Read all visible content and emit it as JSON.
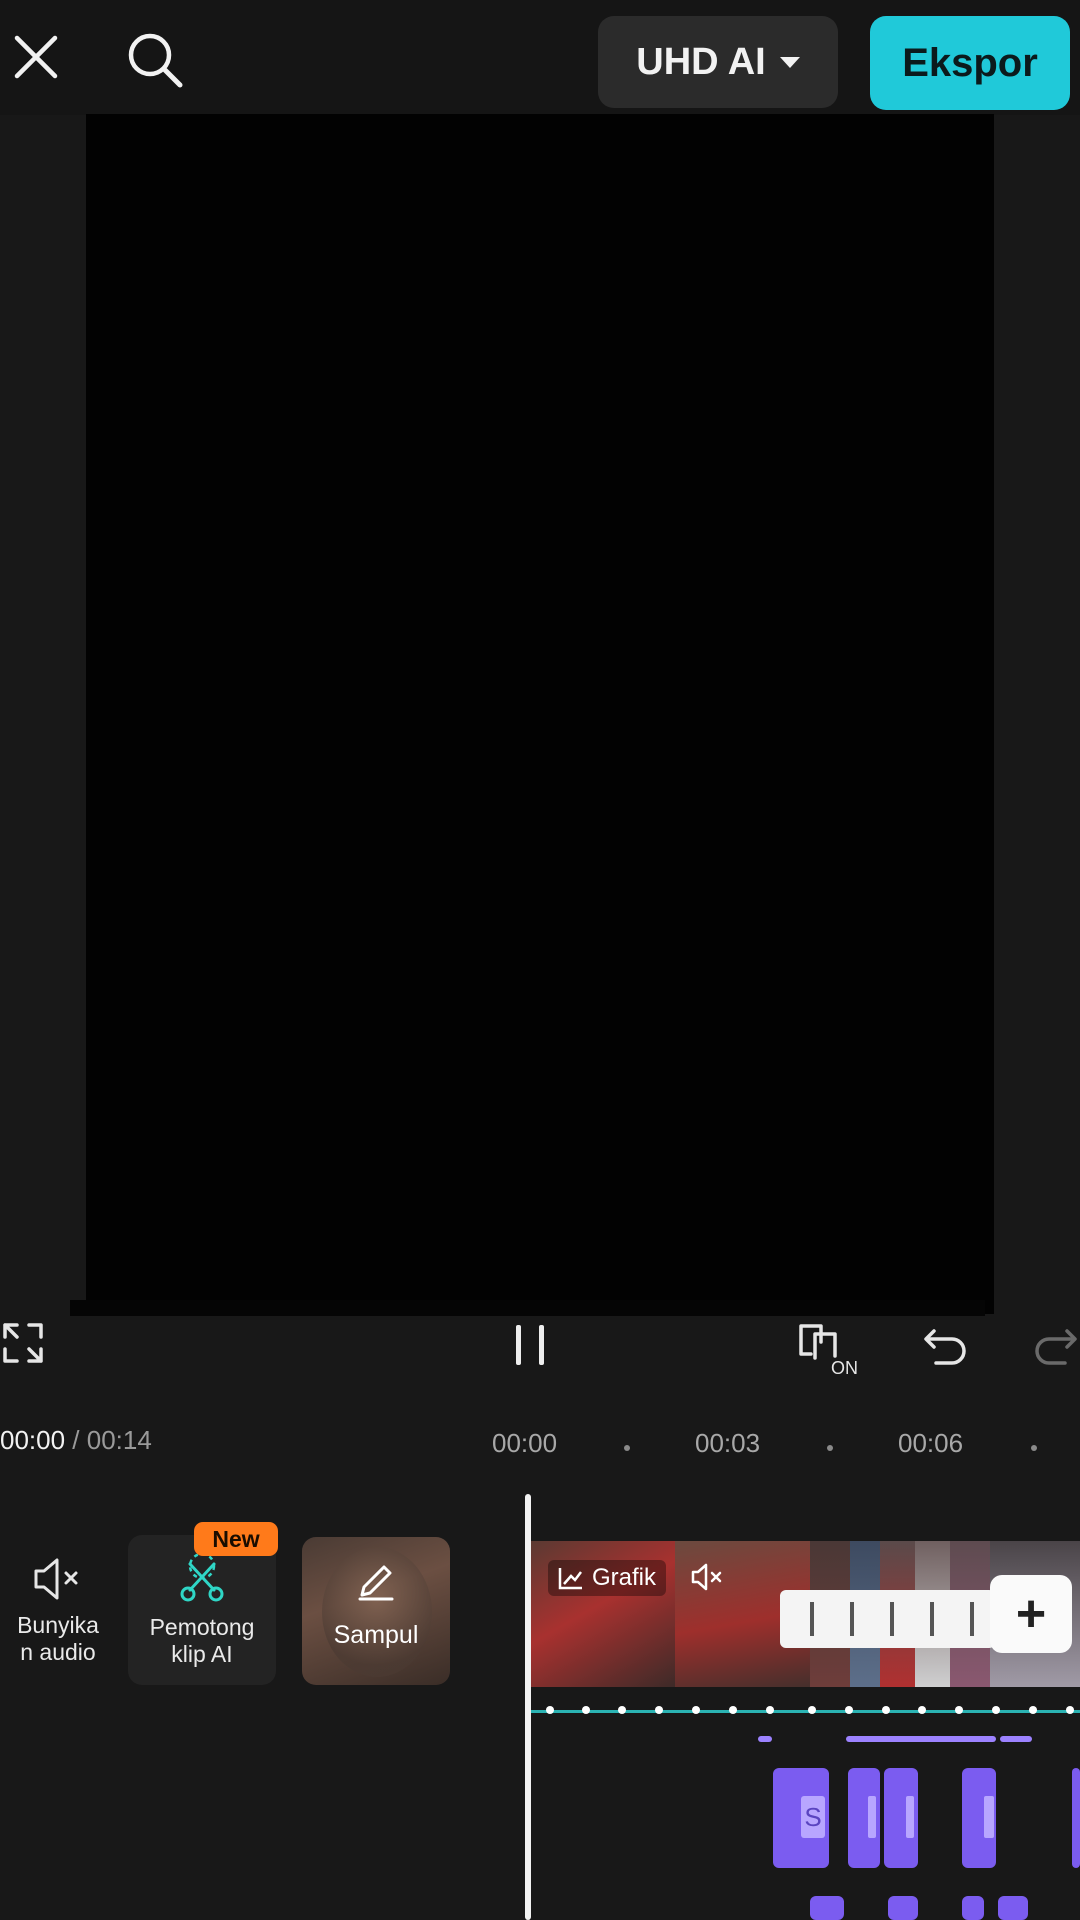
{
  "header": {
    "quality_label": "UHD AI",
    "export_label": "Ekspor"
  },
  "player": {
    "current_time": "00:00",
    "separator": " / ",
    "total_time": "00:14"
  },
  "ruler": {
    "marks": [
      "00:00",
      "00:03",
      "00:06"
    ]
  },
  "tools": {
    "mute_label": "Bunyika\nn audio",
    "ai_cutter_label": "Pemotong\nklip AI",
    "new_badge": "New",
    "cover_label": "Sampul"
  },
  "timeline": {
    "graph_label": "Grafik",
    "add_symbol": "+",
    "caption_letter": "S"
  },
  "colors": {
    "accent": "#20c9d9",
    "badge": "#ff7a1a",
    "caption_track": "#7b5cf0",
    "keyframe_line": "#2bb3b3"
  }
}
